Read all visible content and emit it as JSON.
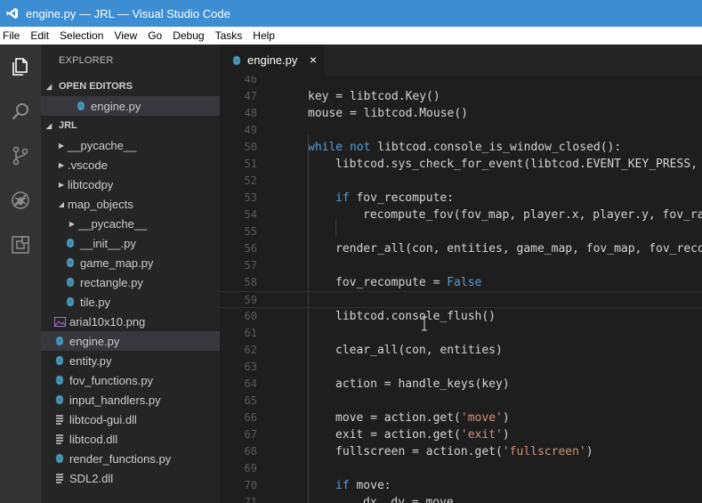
{
  "window": {
    "title": "engine.py — JRL — Visual Studio Code"
  },
  "menu": [
    "File",
    "Edit",
    "Selection",
    "View",
    "Go",
    "Debug",
    "Tasks",
    "Help"
  ],
  "activity_bar": [
    "files-icon",
    "search-icon",
    "source-control-icon",
    "debug-icon",
    "extensions-icon"
  ],
  "sidebar": {
    "title": "EXPLORER",
    "open_editors": {
      "label": "OPEN EDITORS",
      "items": [
        "engine.py"
      ]
    },
    "project": {
      "label": "JRL"
    },
    "tree": [
      {
        "label": "__pycache__",
        "type": "folder"
      },
      {
        "label": ".vscode",
        "type": "folder"
      },
      {
        "label": "libtcodpy",
        "type": "folder"
      },
      {
        "label": "map_objects",
        "type": "folder-open"
      },
      {
        "label": "__pycache__",
        "type": "folder"
      },
      {
        "label": "__init__.py",
        "type": "py"
      },
      {
        "label": "game_map.py",
        "type": "py"
      },
      {
        "label": "rectangle.py",
        "type": "py"
      },
      {
        "label": "tile.py",
        "type": "py"
      },
      {
        "label": "arial10x10.png",
        "type": "png"
      },
      {
        "label": "engine.py",
        "type": "py",
        "selected": true
      },
      {
        "label": "entity.py",
        "type": "py"
      },
      {
        "label": "fov_functions.py",
        "type": "py"
      },
      {
        "label": "input_handlers.py",
        "type": "py"
      },
      {
        "label": "libtcod-gui.dll",
        "type": "dll"
      },
      {
        "label": "libtcod.dll",
        "type": "dll"
      },
      {
        "label": "render_functions.py",
        "type": "py"
      },
      {
        "label": "SDL2.dll",
        "type": "dll"
      }
    ]
  },
  "editor": {
    "tab": {
      "label": "engine.py",
      "close_glyph": "×"
    },
    "lines": [
      {
        "n": "46",
        "indent": 0,
        "tokens": []
      },
      {
        "n": "47",
        "indent": 0,
        "tokens": [
          [
            "t",
            "key = libtcod.Key()"
          ]
        ]
      },
      {
        "n": "48",
        "indent": 0,
        "tokens": [
          [
            "t",
            "mouse = libtcod.Mouse()"
          ]
        ]
      },
      {
        "n": "49",
        "indent": 0,
        "tokens": []
      },
      {
        "n": "50",
        "indent": 0,
        "tokens": [
          [
            "kw",
            "while"
          ],
          [
            "t",
            " "
          ],
          [
            "kw",
            "not"
          ],
          [
            "t",
            " libtcod.console_is_window_closed():"
          ]
        ]
      },
      {
        "n": "51",
        "indent": 1,
        "tokens": [
          [
            "t",
            "libtcod.sys_check_for_event(libtcod.EVENT_KEY_PRESS, k"
          ]
        ]
      },
      {
        "n": "52",
        "indent": 0,
        "tokens": []
      },
      {
        "n": "53",
        "indent": 1,
        "tokens": [
          [
            "kw",
            "if"
          ],
          [
            "t",
            " fov_recompute:"
          ]
        ]
      },
      {
        "n": "54",
        "indent": 2,
        "tokens": [
          [
            "t",
            "recompute_fov(fov_map, player.x, player.y, fov_rad"
          ]
        ]
      },
      {
        "n": "55",
        "indent": 0,
        "tokens": []
      },
      {
        "n": "56",
        "indent": 1,
        "tokens": [
          [
            "t",
            "render_all(con, entities, game_map, fov_map, fov_recom"
          ]
        ]
      },
      {
        "n": "57",
        "indent": 0,
        "tokens": []
      },
      {
        "n": "58",
        "indent": 1,
        "tokens": [
          [
            "t",
            "fov_recompute = "
          ],
          [
            "kw",
            "False"
          ]
        ]
      },
      {
        "n": "59",
        "indent": 0,
        "tokens": [],
        "current": true
      },
      {
        "n": "60",
        "indent": 1,
        "tokens": [
          [
            "t",
            "libtcod.console_flush()"
          ]
        ]
      },
      {
        "n": "61",
        "indent": 0,
        "tokens": []
      },
      {
        "n": "62",
        "indent": 1,
        "tokens": [
          [
            "t",
            "clear_all(con, entities)"
          ]
        ]
      },
      {
        "n": "63",
        "indent": 0,
        "tokens": []
      },
      {
        "n": "64",
        "indent": 1,
        "tokens": [
          [
            "t",
            "action = handle_keys(key)"
          ]
        ]
      },
      {
        "n": "65",
        "indent": 0,
        "tokens": []
      },
      {
        "n": "66",
        "indent": 1,
        "tokens": [
          [
            "t",
            "move = action.get("
          ],
          [
            "str",
            "'move'"
          ],
          [
            "t",
            ")"
          ]
        ]
      },
      {
        "n": "67",
        "indent": 1,
        "tokens": [
          [
            "t",
            "exit = action.get("
          ],
          [
            "str",
            "'exit'"
          ],
          [
            "t",
            ")"
          ]
        ]
      },
      {
        "n": "68",
        "indent": 1,
        "tokens": [
          [
            "t",
            "fullscreen = action.get("
          ],
          [
            "str",
            "'fullscreen'"
          ],
          [
            "t",
            ")"
          ]
        ]
      },
      {
        "n": "69",
        "indent": 0,
        "tokens": []
      },
      {
        "n": "70",
        "indent": 1,
        "tokens": [
          [
            "kw",
            "if"
          ],
          [
            "t",
            " move:"
          ]
        ]
      },
      {
        "n": "71",
        "indent": 2,
        "tokens": [
          [
            "t",
            "dx, dy = move"
          ]
        ]
      }
    ]
  },
  "colors": {
    "title_bar": "#3c8dd2",
    "keyword": "#569cd6",
    "string": "#ce9178",
    "python_icon": "#519aba"
  }
}
